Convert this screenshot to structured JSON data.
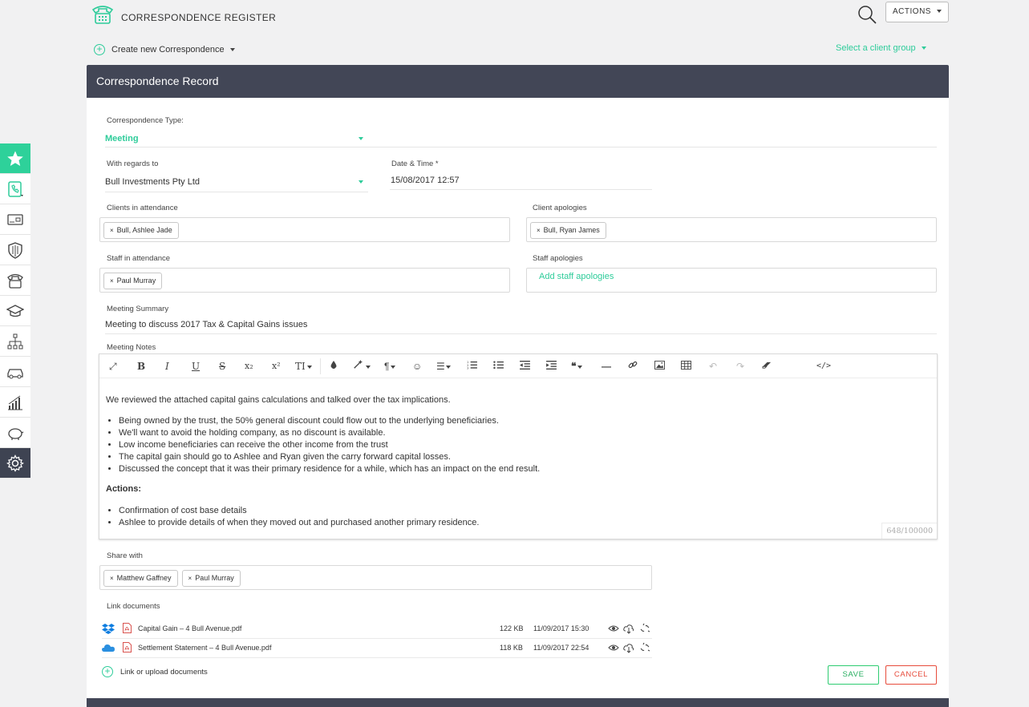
{
  "header": {
    "app_title": "CORRESPONDENCE REGISTER",
    "actions_label": "ACTIONS"
  },
  "subheader": {
    "create_new_label": "Create new Correspondence",
    "client_group_label": "Select a client group"
  },
  "sidebar": {
    "items": [
      "star-icon",
      "correspondence-icon",
      "card-icon",
      "shield-icon",
      "phone-icon",
      "graduation-cap-icon",
      "org-chart-icon",
      "car-icon",
      "bar-chart-icon",
      "piggy-bank-icon",
      "gear-icon"
    ]
  },
  "panel": {
    "title": "Correspondence Record"
  },
  "form": {
    "type_label": "Correspondence Type:",
    "type_value": "Meeting",
    "regards_label": "With regards to",
    "regards_value": "Bull Investments Pty Ltd",
    "datetime_label": "Date & Time *",
    "datetime_value": "15/08/2017 12:57",
    "clients_attendance_label": "Clients in attendance",
    "clients_attendance": [
      "Bull, Ashlee Jade"
    ],
    "client_apologies_label": "Client apologies",
    "client_apologies": [
      "Bull, Ryan James"
    ],
    "staff_attendance_label": "Staff in attendance",
    "staff_attendance": [
      "Paul Murray"
    ],
    "staff_apologies_label": "Staff apologies",
    "staff_apologies_placeholder": "Add staff apologies",
    "summary_label": "Meeting Summary",
    "summary_value": "Meeting to discuss 2017 Tax & Capital Gains issues",
    "notes_label": "Meeting Notes",
    "share_label": "Share with",
    "share_with": [
      "Matthew Gaffney",
      "Paul Murray"
    ],
    "link_docs_label": "Link documents",
    "link_upload_label": "Link or upload documents",
    "save_label": "SAVE",
    "cancel_label": "CANCEL"
  },
  "editor": {
    "intro": "We reviewed the attached capital gains calculations and talked over the tax implications.",
    "bullets": [
      "Being owned by the trust, the 50% general discount could flow out to the underlying beneficiaries.",
      "We'll want to avoid the holding company, as no discount is available.",
      "Low income beneficiaries can receive the other income from the trust",
      "The capital gain should go to Ashlee and Ryan given the carry forward capital losses.",
      "Discussed the concept that it was their primary residence for a while, which has an impact on the end result."
    ],
    "actions_heading": "Actions:",
    "action_items": [
      "Confirmation of cost base details",
      "Ashlee to provide details of when they moved out and purchased another primary residence."
    ],
    "char_count": "648/100000",
    "toolbar": {
      "bold": "B",
      "italic": "I",
      "underline": "U",
      "strikethrough": "S",
      "subscript": "x₂",
      "superscript": "x²",
      "font_size": "TI"
    }
  },
  "documents": [
    {
      "name": "Capital Gain – 4 Bull Avenue.pdf",
      "size": "122 KB",
      "date": "11/09/2017 15:30",
      "source": "dropbox"
    },
    {
      "name": "Settlement Statement – 4 Bull Avenue.pdf",
      "size": "118 KB",
      "date": "11/09/2017 22:54",
      "source": "onedrive"
    }
  ],
  "colors": {
    "accent": "#2ecc9a",
    "header_bg": "#424656",
    "save": "#27ae60",
    "cancel": "#e74c3c"
  }
}
